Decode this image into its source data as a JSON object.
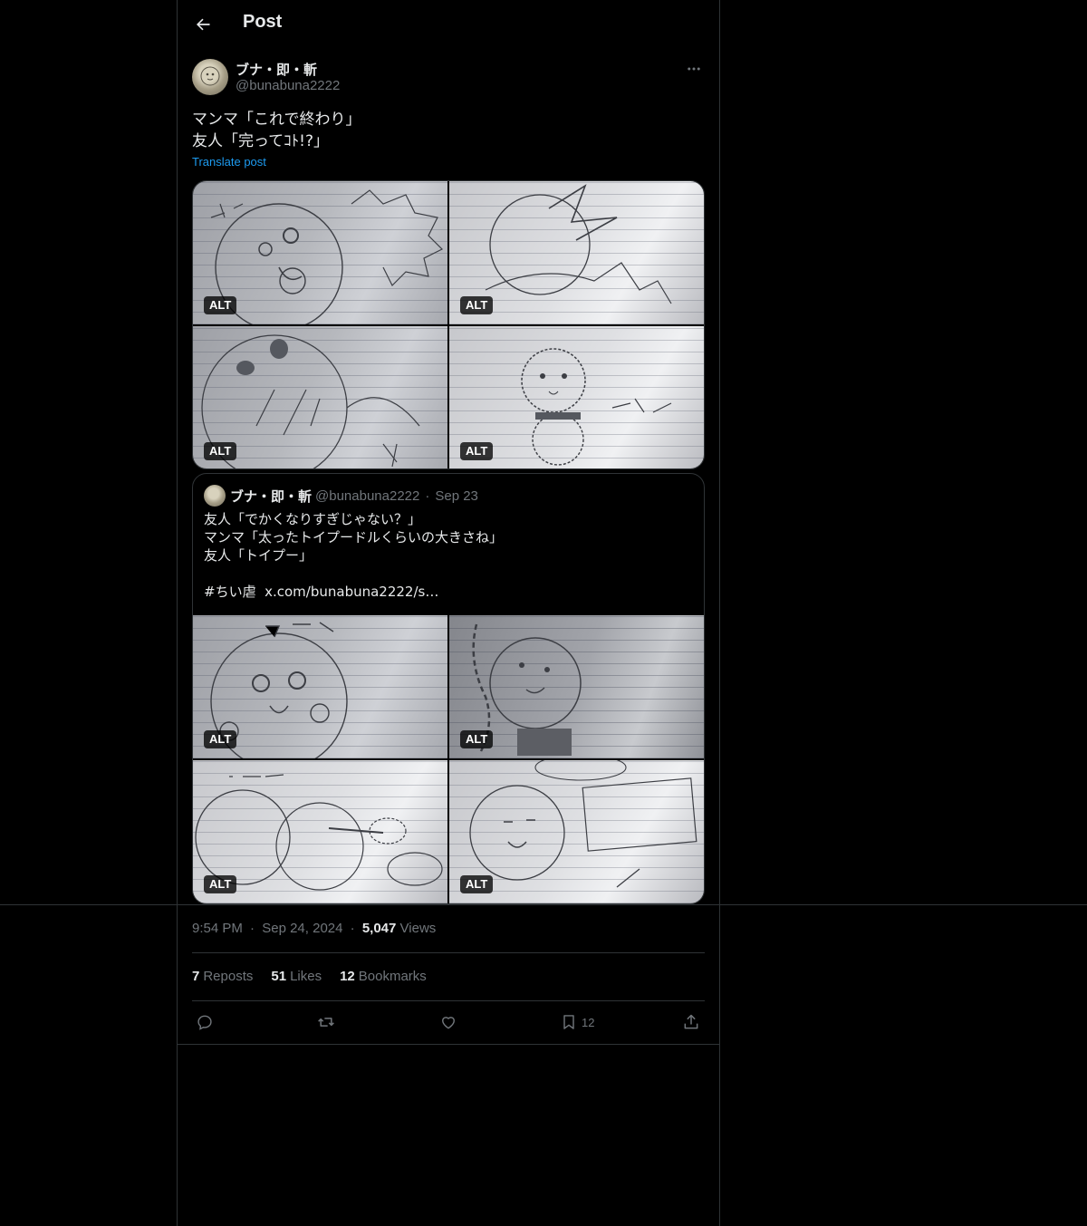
{
  "header": {
    "title": "Post"
  },
  "post": {
    "author_name": "ブナ・即・斬",
    "author_handle": "@bunabuna2222",
    "text_line1": "マンマ「これで終わり」",
    "text_line2": "友人「完ってｺﾄ!?」",
    "translate_label": "Translate post",
    "alt_label": "ALT"
  },
  "quote": {
    "author_name": "ブナ・即・斬",
    "author_handle": "@bunabuna2222",
    "separator": "·",
    "date": "Sep 23",
    "lines": [
      "友人「でかくなりすぎじゃない？」",
      "マンマ「太ったトイプードルくらいの大きさね」",
      "友人「トイプー」",
      "",
      "#ちい虐  x.com/bunabuna2222/s…"
    ]
  },
  "meta": {
    "time": "9:54 PM",
    "separator": "·",
    "date": "Sep 24, 2024",
    "views_count": "5,047",
    "views_label": "Views"
  },
  "stats": {
    "reposts_count": "7",
    "reposts_label": "Reposts",
    "likes_count": "51",
    "likes_label": "Likes",
    "bookmarks_count": "12",
    "bookmarks_label": "Bookmarks"
  },
  "actions": {
    "bookmark_count": "12"
  },
  "icons": [
    "back-arrow-icon",
    "more-icon",
    "reply-icon",
    "repost-icon",
    "like-icon",
    "bookmark-icon",
    "share-icon"
  ],
  "colors": {
    "background": "#000000",
    "text": "#e7e9ea",
    "muted": "#71767b",
    "accent": "#1d9bf0",
    "border": "#2f3336"
  }
}
